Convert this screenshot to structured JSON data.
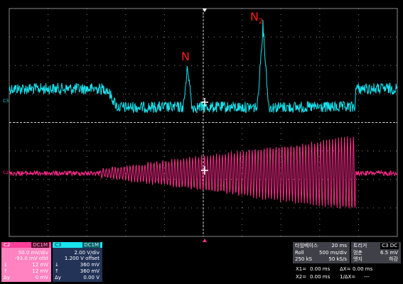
{
  "labels": {
    "n1": "N",
    "n2_main": "N",
    "n2_sub": "2",
    "c3_tag": "C3",
    "c2_tag": "C2"
  },
  "ch2_panel": {
    "name": "C2",
    "coupling": "DC1M",
    "rows": [
      {
        "k": "",
        "v": "50.0 mV/div"
      },
      {
        "k": "",
        "v": "-93.0 mV ofst"
      },
      {
        "k": "↓",
        "v": "12 mV"
      },
      {
        "k": "↑",
        "v": "12 mV"
      },
      {
        "k": "Δy",
        "v": "0 mV"
      }
    ]
  },
  "ch3_panel": {
    "name": "C3",
    "coupling": "DC1M",
    "rows": [
      {
        "k": "",
        "v": "2.00 V/div"
      },
      {
        "k": "",
        "v": "1.200 V offset"
      },
      {
        "k": "↓",
        "v": "360 mV"
      },
      {
        "k": "↑",
        "v": "360 mV"
      },
      {
        "k": "Δy",
        "v": "0.00 V"
      }
    ]
  },
  "timebase": {
    "title": "타임베이스",
    "delay": "20 ms",
    "mode": "Roll",
    "div": "500 ms/div",
    "samples": "250 kS",
    "rate": "50 kS/s"
  },
  "trigger": {
    "title": "트리거",
    "source": "C3 DC",
    "mode": "멈춘",
    "level": "6.5 mV",
    "type": "엣지",
    "slope": "하강"
  },
  "cursors": {
    "x1": "X1=",
    "x1_val": "0.00 ms",
    "dx": "ΔX=",
    "dx_val": "0.00 ms",
    "x2": "X2=",
    "x2_val": "0.00 ms",
    "inv_dx": "1/ΔX=",
    "inv_dx_val": "---"
  },
  "colors": {
    "ch3": "#19e3ee",
    "ch2": "#ff2a8c",
    "grid": "#8a8a8a",
    "label_red": "#ff1a1a",
    "panel_ch2_bg": "#ff83c1",
    "panel_ch3_bg": "#223357",
    "panel_gray_bg": "#404048"
  }
}
